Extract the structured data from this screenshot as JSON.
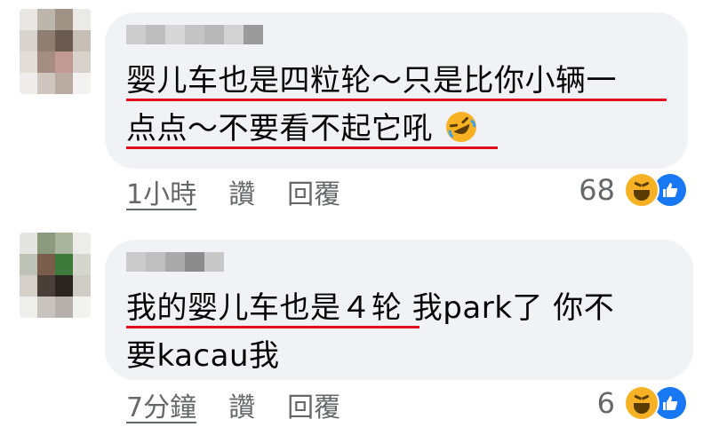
{
  "comments": [
    {
      "lines": [
        "婴儿车也是四粒轮～只是比你小辆一",
        "点点～不要看不起它吼"
      ],
      "time": "1小時",
      "like_label": "讚",
      "reply_label": "回覆",
      "reaction_count": "68",
      "reactions": [
        "haha-icon",
        "like-icon"
      ]
    },
    {
      "lines": [
        "我的婴儿车也是４轮 我park了 你不",
        "要kacau我"
      ],
      "time": "7分鐘",
      "like_label": "讚",
      "reply_label": "回覆",
      "reaction_count": "6",
      "reactions": [
        "haha-icon",
        "like-icon"
      ]
    }
  ],
  "colors": {
    "bubble": "#f0f2f5",
    "meta_text": "#65676b",
    "highlight_underline": "#e10e1e",
    "like_blue": "#1877f2",
    "haha_yellow": "#f7b125"
  }
}
